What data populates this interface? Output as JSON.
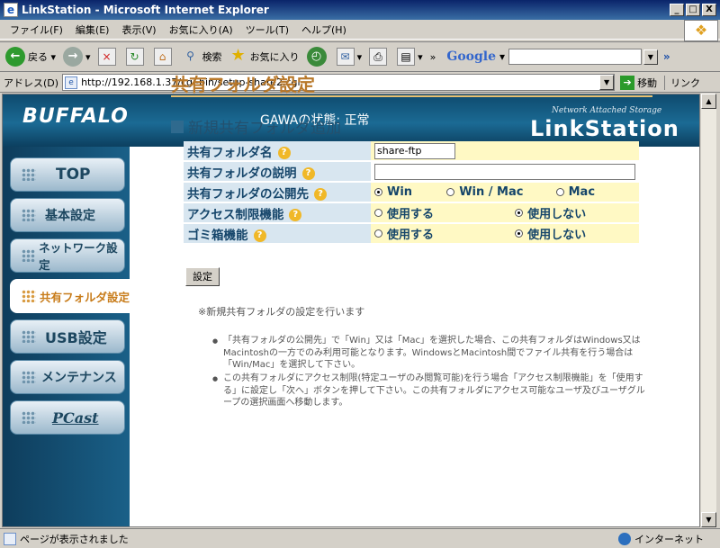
{
  "window": {
    "title": "LinkStation - Microsoft Internet Explorer",
    "min": "_",
    "max": "□",
    "close": "X"
  },
  "menu": [
    "ファイル(F)",
    "編集(E)",
    "表示(V)",
    "お気に入り(A)",
    "ツール(T)",
    "ヘルプ(H)"
  ],
  "toolbar": {
    "back": "戻る",
    "search": "検索",
    "favorites": "お気に入り",
    "google": "Google",
    "more": "»"
  },
  "address": {
    "label": "アドレス(D)",
    "url": "http://192.168.1.37/cgi-bin/setup-share2.cgi",
    "go": "移動",
    "links": "リンク"
  },
  "header": {
    "brand": "BUFFALO",
    "status": "GAWAの状態: 正常",
    "tagline": "Network Attached Storage",
    "product": "LinkStation"
  },
  "nav": [
    {
      "label": "TOP",
      "active": false
    },
    {
      "label": "基本設定",
      "active": false
    },
    {
      "label": "ネットワーク設定",
      "active": false
    },
    {
      "label": "共有フォルダ設定",
      "active": true
    },
    {
      "label": "USB設定",
      "active": false
    },
    {
      "label": "メンテナンス",
      "active": false
    },
    {
      "label": "PCast",
      "active": false
    }
  ],
  "page": {
    "title": "共有フォルダ設定",
    "section": "新規共有フォルダ追加"
  },
  "form": {
    "name_label": "共有フォルダ名",
    "name_value": "share-ftp",
    "desc_label": "共有フォルダの説明",
    "desc_value": "",
    "pub_label": "共有フォルダの公開先",
    "pub_options": [
      "Win",
      "Win / Mac",
      "Mac"
    ],
    "pub_selected": 0,
    "acl_label": "アクセス制限機能",
    "acl_options": [
      "使用する",
      "使用しない"
    ],
    "acl_selected": 1,
    "trash_label": "ゴミ箱機能",
    "trash_options": [
      "使用する",
      "使用しない"
    ],
    "trash_selected": 1,
    "help": "?",
    "submit": "設定"
  },
  "notes": {
    "main": "※新規共有フォルダの設定を行います",
    "bullet1": "「共有フォルダの公開先」で「Win」又は「Mac」を選択した場合、この共有フォルダはWindows又はMacintoshの一方でのみ利用可能となります。WindowsとMacintosh間でファイル共有を行う場合は「Win/Mac」を選択して下さい。",
    "bullet2": "この共有フォルダにアクセス制限(特定ユーザのみ閲覧可能)を行う場合「アクセス制限機能」を「使用する」に設定し「次へ」ボタンを押して下さい。この共有フォルダにアクセス可能なユーザ及びユーザグループの選択画面へ移動します。"
  },
  "statusbar": {
    "text": "ページが表示されました",
    "zone": "インターネット"
  }
}
